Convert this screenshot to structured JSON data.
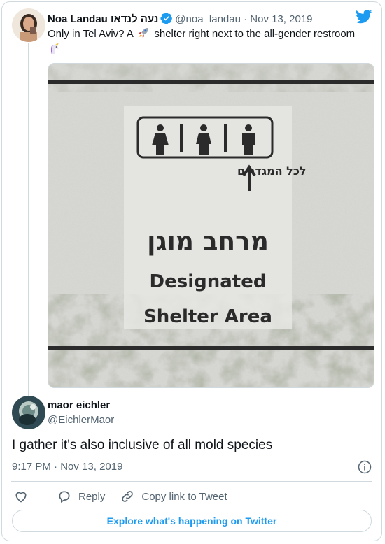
{
  "tweet": {
    "author_name": "Noa Landau נעה לנדאו",
    "handle": "@noa_landau",
    "separator": "·",
    "date": "Nov 13, 2019",
    "text_before_emoji": "Only in Tel Aviv? A",
    "text_after_emoji": " shelter right next to the all-gender restroom",
    "image": {
      "sign_hebrew_top": "לכל המגדרים",
      "sign_hebrew_main": "מרחב מוגן",
      "sign_english_line1": "Designated",
      "sign_english_line2": "Shelter Area"
    }
  },
  "reply": {
    "author_name": "maor eichler",
    "handle": "@EichlerMaor",
    "text": "I gather it's also inclusive of all mold species",
    "time": "9:17 PM",
    "date": "Nov 13, 2019",
    "separator": "·"
  },
  "actions": {
    "reply_label": "Reply",
    "copy_label": "Copy link to Tweet"
  },
  "footer": {
    "explore_label": "Explore what's happening on Twitter"
  },
  "colors": {
    "accent": "#1d9bf0",
    "muted": "#536471",
    "border": "#cfd9de"
  }
}
